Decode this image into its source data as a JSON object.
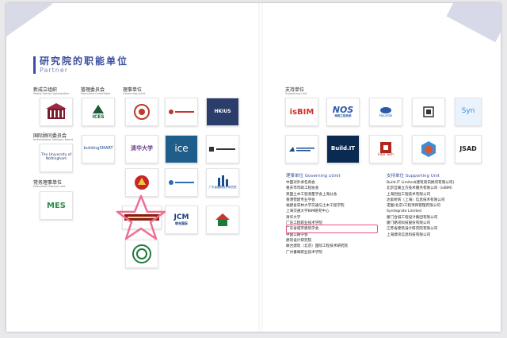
{
  "title": "研究院的职能单位",
  "subtitle": "Partner",
  "groups": {
    "new_org": {
      "zh": "新成立组织",
      "en": "Newly Setup Organization"
    },
    "advisory": {
      "zh": "国际顾问委员会",
      "en": "International Advisory Board"
    },
    "executive": {
      "zh": "常务理事单位",
      "en": "Executive Director Unit"
    },
    "committee": {
      "zh": "管理委员会",
      "en": "Executive Committee"
    },
    "governing": {
      "zh": "理事单位",
      "en": "Governing uUnit"
    },
    "supporting": {
      "zh": "支持单位",
      "en": "Supporting Unit"
    }
  },
  "logos": {
    "nottingham": "The University of Nottingham",
    "mes": "MES",
    "ices": "ICES",
    "buildingsmart": "buildingSMART",
    "tsinghua": "清华大学",
    "ice": "ice",
    "hkius": "HKIUS",
    "jcm": "JCM",
    "jcm_sub": "联合国际",
    "gdcec": "广东省建筑设计研究院",
    "isbim": "isBIM",
    "nos": "NOS",
    "nos_sub": "网络工程系统",
    "hyundai": "Hyundai",
    "syn": "Syn",
    "buildit": "Build.IT",
    "inter_tech": "Inter Tech",
    "jsad": "JSAD"
  },
  "governing_list": {
    "heading": "理事单位 Governing uUnit",
    "items": [
      "中国对外承包商会",
      "重庆市市政工程协会",
      "英国土木工程测量学会上海分会",
      "香港营建专业学会",
      "福建省农林大学交通与土木工程学院",
      "上海交通大学BIM研究中心",
      "清华大学",
      "广东工程职业技术学院",
      "广东省城市建筑学会",
      "中国公路学会",
      "建筑设计研究院",
      "联合建筑（北京）国际工程技术研究院",
      "广州番禺职业技术学院"
    ]
  },
  "supporting_list": {
    "heading": "支持单位 Supporting Unit",
    "items": [
      "Build.IT Limited(建筑资讯顾问有限公司)",
      "北京互联立方技术服务有限公司（isBIM）",
      "上海因恒工程技术有限公司",
      "达索析统（上海）信息技术有限公司",
      "诺图(北京)工程项目管理有限公司",
      "Syntegrate Limited",
      "厦门合诚工程设计集团有限公司",
      "厦门路讯科技股份有限公司",
      "江苏省建筑设计研究院有限公司",
      "上海建讯信息科技有限公司"
    ]
  }
}
